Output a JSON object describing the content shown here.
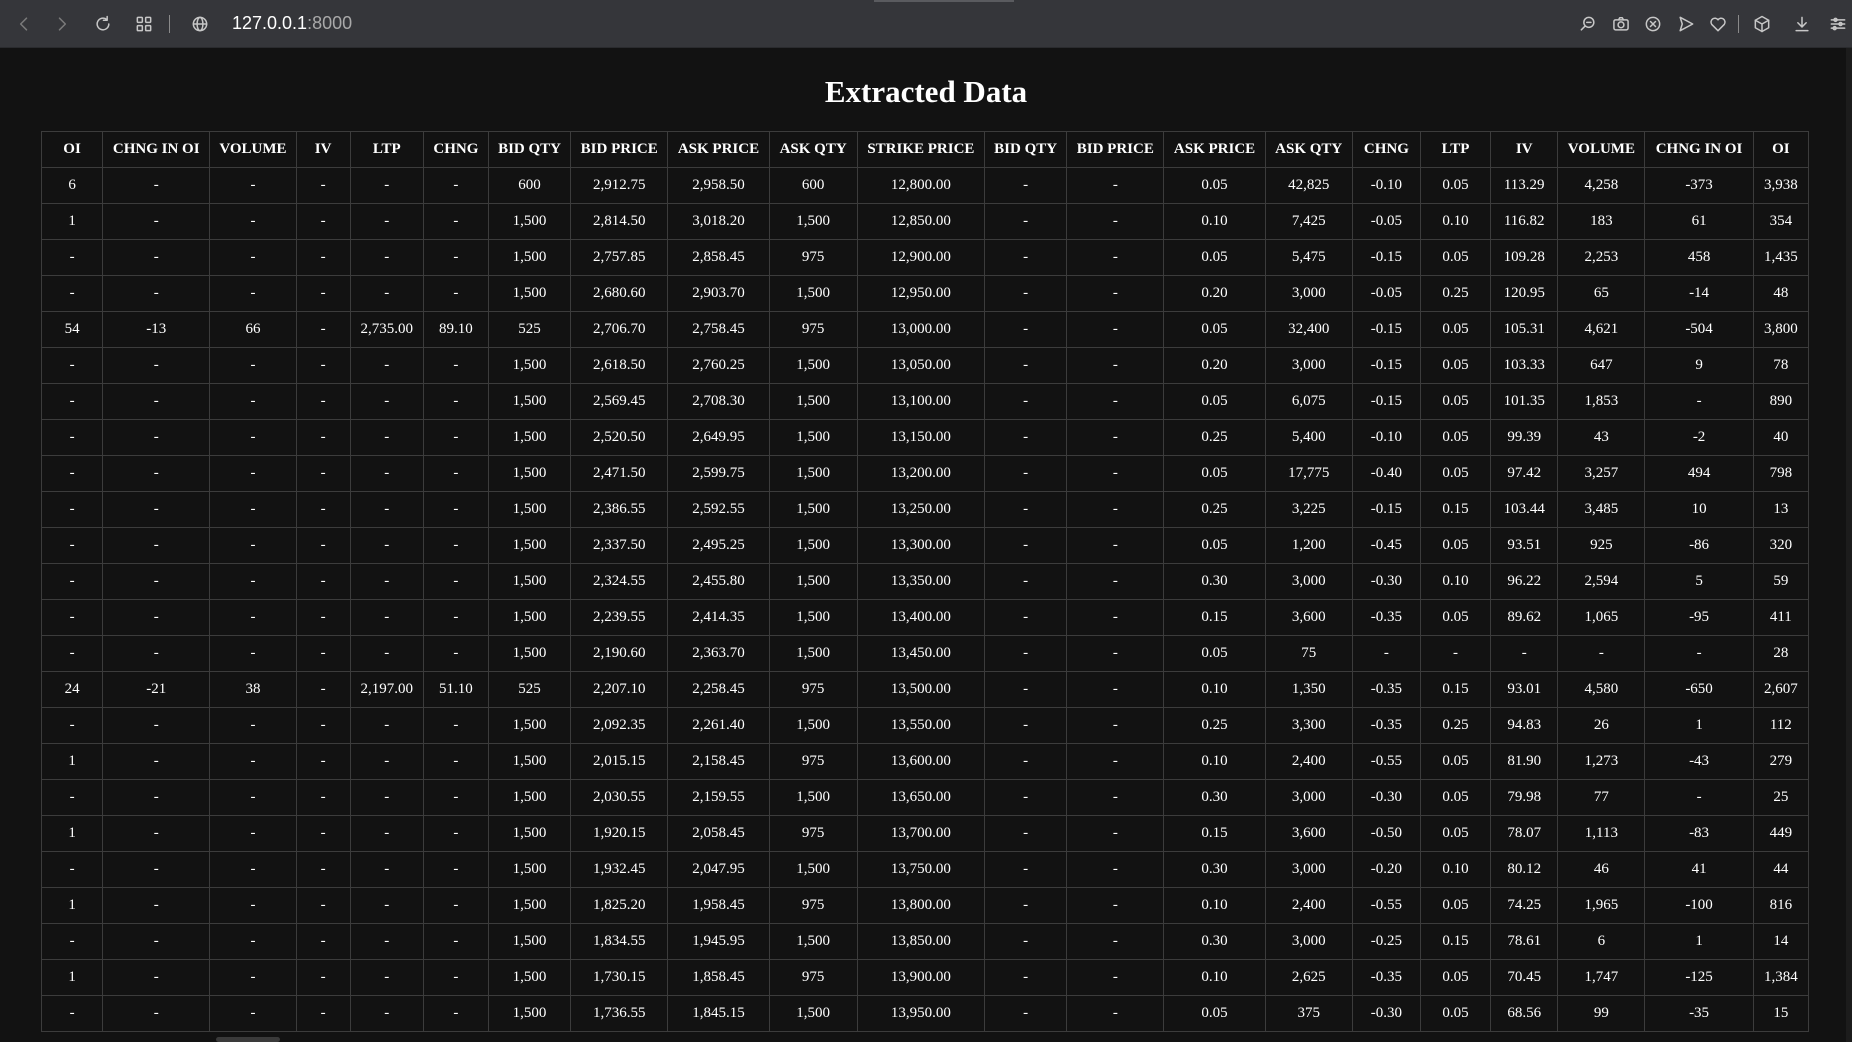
{
  "browser": {
    "url_host": "127.0.0.1",
    "url_port": ":8000"
  },
  "page": {
    "title": "Extracted Data"
  },
  "table": {
    "headers": [
      "OI",
      "CHNG IN OI",
      "VOLUME",
      "IV",
      "LTP",
      "CHNG",
      "BID QTY",
      "BID PRICE",
      "ASK PRICE",
      "ASK QTY",
      "STRIKE PRICE",
      "BID QTY",
      "BID PRICE",
      "ASK PRICE",
      "ASK QTY",
      "CHNG",
      "LTP",
      "IV",
      "VOLUME",
      "CHNG IN OI",
      "OI"
    ],
    "rows": [
      [
        "6",
        "-",
        "-",
        "-",
        "-",
        "-",
        "600",
        "2,912.75",
        "2,958.50",
        "600",
        "12,800.00",
        "-",
        "-",
        "0.05",
        "42,825",
        "-0.10",
        "0.05",
        "113.29",
        "4,258",
        "-373",
        "3,938"
      ],
      [
        "1",
        "-",
        "-",
        "-",
        "-",
        "-",
        "1,500",
        "2,814.50",
        "3,018.20",
        "1,500",
        "12,850.00",
        "-",
        "-",
        "0.10",
        "7,425",
        "-0.05",
        "0.10",
        "116.82",
        "183",
        "61",
        "354"
      ],
      [
        "-",
        "-",
        "-",
        "-",
        "-",
        "-",
        "1,500",
        "2,757.85",
        "2,858.45",
        "975",
        "12,900.00",
        "-",
        "-",
        "0.05",
        "5,475",
        "-0.15",
        "0.05",
        "109.28",
        "2,253",
        "458",
        "1,435"
      ],
      [
        "-",
        "-",
        "-",
        "-",
        "-",
        "-",
        "1,500",
        "2,680.60",
        "2,903.70",
        "1,500",
        "12,950.00",
        "-",
        "-",
        "0.20",
        "3,000",
        "-0.05",
        "0.25",
        "120.95",
        "65",
        "-14",
        "48"
      ],
      [
        "54",
        "-13",
        "66",
        "-",
        "2,735.00",
        "89.10",
        "525",
        "2,706.70",
        "2,758.45",
        "975",
        "13,000.00",
        "-",
        "-",
        "0.05",
        "32,400",
        "-0.15",
        "0.05",
        "105.31",
        "4,621",
        "-504",
        "3,800"
      ],
      [
        "-",
        "-",
        "-",
        "-",
        "-",
        "-",
        "1,500",
        "2,618.50",
        "2,760.25",
        "1,500",
        "13,050.00",
        "-",
        "-",
        "0.20",
        "3,000",
        "-0.15",
        "0.05",
        "103.33",
        "647",
        "9",
        "78"
      ],
      [
        "-",
        "-",
        "-",
        "-",
        "-",
        "-",
        "1,500",
        "2,569.45",
        "2,708.30",
        "1,500",
        "13,100.00",
        "-",
        "-",
        "0.05",
        "6,075",
        "-0.15",
        "0.05",
        "101.35",
        "1,853",
        "-",
        "890"
      ],
      [
        "-",
        "-",
        "-",
        "-",
        "-",
        "-",
        "1,500",
        "2,520.50",
        "2,649.95",
        "1,500",
        "13,150.00",
        "-",
        "-",
        "0.25",
        "5,400",
        "-0.10",
        "0.05",
        "99.39",
        "43",
        "-2",
        "40"
      ],
      [
        "-",
        "-",
        "-",
        "-",
        "-",
        "-",
        "1,500",
        "2,471.50",
        "2,599.75",
        "1,500",
        "13,200.00",
        "-",
        "-",
        "0.05",
        "17,775",
        "-0.40",
        "0.05",
        "97.42",
        "3,257",
        "494",
        "798"
      ],
      [
        "-",
        "-",
        "-",
        "-",
        "-",
        "-",
        "1,500",
        "2,386.55",
        "2,592.55",
        "1,500",
        "13,250.00",
        "-",
        "-",
        "0.25",
        "3,225",
        "-0.15",
        "0.15",
        "103.44",
        "3,485",
        "10",
        "13"
      ],
      [
        "-",
        "-",
        "-",
        "-",
        "-",
        "-",
        "1,500",
        "2,337.50",
        "2,495.25",
        "1,500",
        "13,300.00",
        "-",
        "-",
        "0.05",
        "1,200",
        "-0.45",
        "0.05",
        "93.51",
        "925",
        "-86",
        "320"
      ],
      [
        "-",
        "-",
        "-",
        "-",
        "-",
        "-",
        "1,500",
        "2,324.55",
        "2,455.80",
        "1,500",
        "13,350.00",
        "-",
        "-",
        "0.30",
        "3,000",
        "-0.30",
        "0.10",
        "96.22",
        "2,594",
        "5",
        "59"
      ],
      [
        "-",
        "-",
        "-",
        "-",
        "-",
        "-",
        "1,500",
        "2,239.55",
        "2,414.35",
        "1,500",
        "13,400.00",
        "-",
        "-",
        "0.15",
        "3,600",
        "-0.35",
        "0.05",
        "89.62",
        "1,065",
        "-95",
        "411"
      ],
      [
        "-",
        "-",
        "-",
        "-",
        "-",
        "-",
        "1,500",
        "2,190.60",
        "2,363.70",
        "1,500",
        "13,450.00",
        "-",
        "-",
        "0.05",
        "75",
        "-",
        "-",
        "-",
        "-",
        "-",
        "28"
      ],
      [
        "24",
        "-21",
        "38",
        "-",
        "2,197.00",
        "51.10",
        "525",
        "2,207.10",
        "2,258.45",
        "975",
        "13,500.00",
        "-",
        "-",
        "0.10",
        "1,350",
        "-0.35",
        "0.15",
        "93.01",
        "4,580",
        "-650",
        "2,607"
      ],
      [
        "-",
        "-",
        "-",
        "-",
        "-",
        "-",
        "1,500",
        "2,092.35",
        "2,261.40",
        "1,500",
        "13,550.00",
        "-",
        "-",
        "0.25",
        "3,300",
        "-0.35",
        "0.25",
        "94.83",
        "26",
        "1",
        "112"
      ],
      [
        "1",
        "-",
        "-",
        "-",
        "-",
        "-",
        "1,500",
        "2,015.15",
        "2,158.45",
        "975",
        "13,600.00",
        "-",
        "-",
        "0.10",
        "2,400",
        "-0.55",
        "0.05",
        "81.90",
        "1,273",
        "-43",
        "279"
      ],
      [
        "-",
        "-",
        "-",
        "-",
        "-",
        "-",
        "1,500",
        "2,030.55",
        "2,159.55",
        "1,500",
        "13,650.00",
        "-",
        "-",
        "0.30",
        "3,000",
        "-0.30",
        "0.05",
        "79.98",
        "77",
        "-",
        "25"
      ],
      [
        "1",
        "-",
        "-",
        "-",
        "-",
        "-",
        "1,500",
        "1,920.15",
        "2,058.45",
        "975",
        "13,700.00",
        "-",
        "-",
        "0.15",
        "3,600",
        "-0.50",
        "0.05",
        "78.07",
        "1,113",
        "-83",
        "449"
      ],
      [
        "-",
        "-",
        "-",
        "-",
        "-",
        "-",
        "1,500",
        "1,932.45",
        "2,047.95",
        "1,500",
        "13,750.00",
        "-",
        "-",
        "0.30",
        "3,000",
        "-0.20",
        "0.10",
        "80.12",
        "46",
        "41",
        "44"
      ],
      [
        "1",
        "-",
        "-",
        "-",
        "-",
        "-",
        "1,500",
        "1,825.20",
        "1,958.45",
        "975",
        "13,800.00",
        "-",
        "-",
        "0.10",
        "2,400",
        "-0.55",
        "0.05",
        "74.25",
        "1,965",
        "-100",
        "816"
      ],
      [
        "-",
        "-",
        "-",
        "-",
        "-",
        "-",
        "1,500",
        "1,834.55",
        "1,945.95",
        "1,500",
        "13,850.00",
        "-",
        "-",
        "0.30",
        "3,000",
        "-0.25",
        "0.15",
        "78.61",
        "6",
        "1",
        "14"
      ],
      [
        "1",
        "-",
        "-",
        "-",
        "-",
        "-",
        "1,500",
        "1,730.15",
        "1,858.45",
        "975",
        "13,900.00",
        "-",
        "-",
        "0.10",
        "2,625",
        "-0.35",
        "0.05",
        "70.45",
        "1,747",
        "-125",
        "1,384"
      ],
      [
        "-",
        "-",
        "-",
        "-",
        "-",
        "-",
        "1,500",
        "1,736.55",
        "1,845.15",
        "1,500",
        "13,950.00",
        "-",
        "-",
        "0.05",
        "375",
        "-0.30",
        "0.05",
        "68.56",
        "99",
        "-35",
        "15"
      ]
    ]
  }
}
